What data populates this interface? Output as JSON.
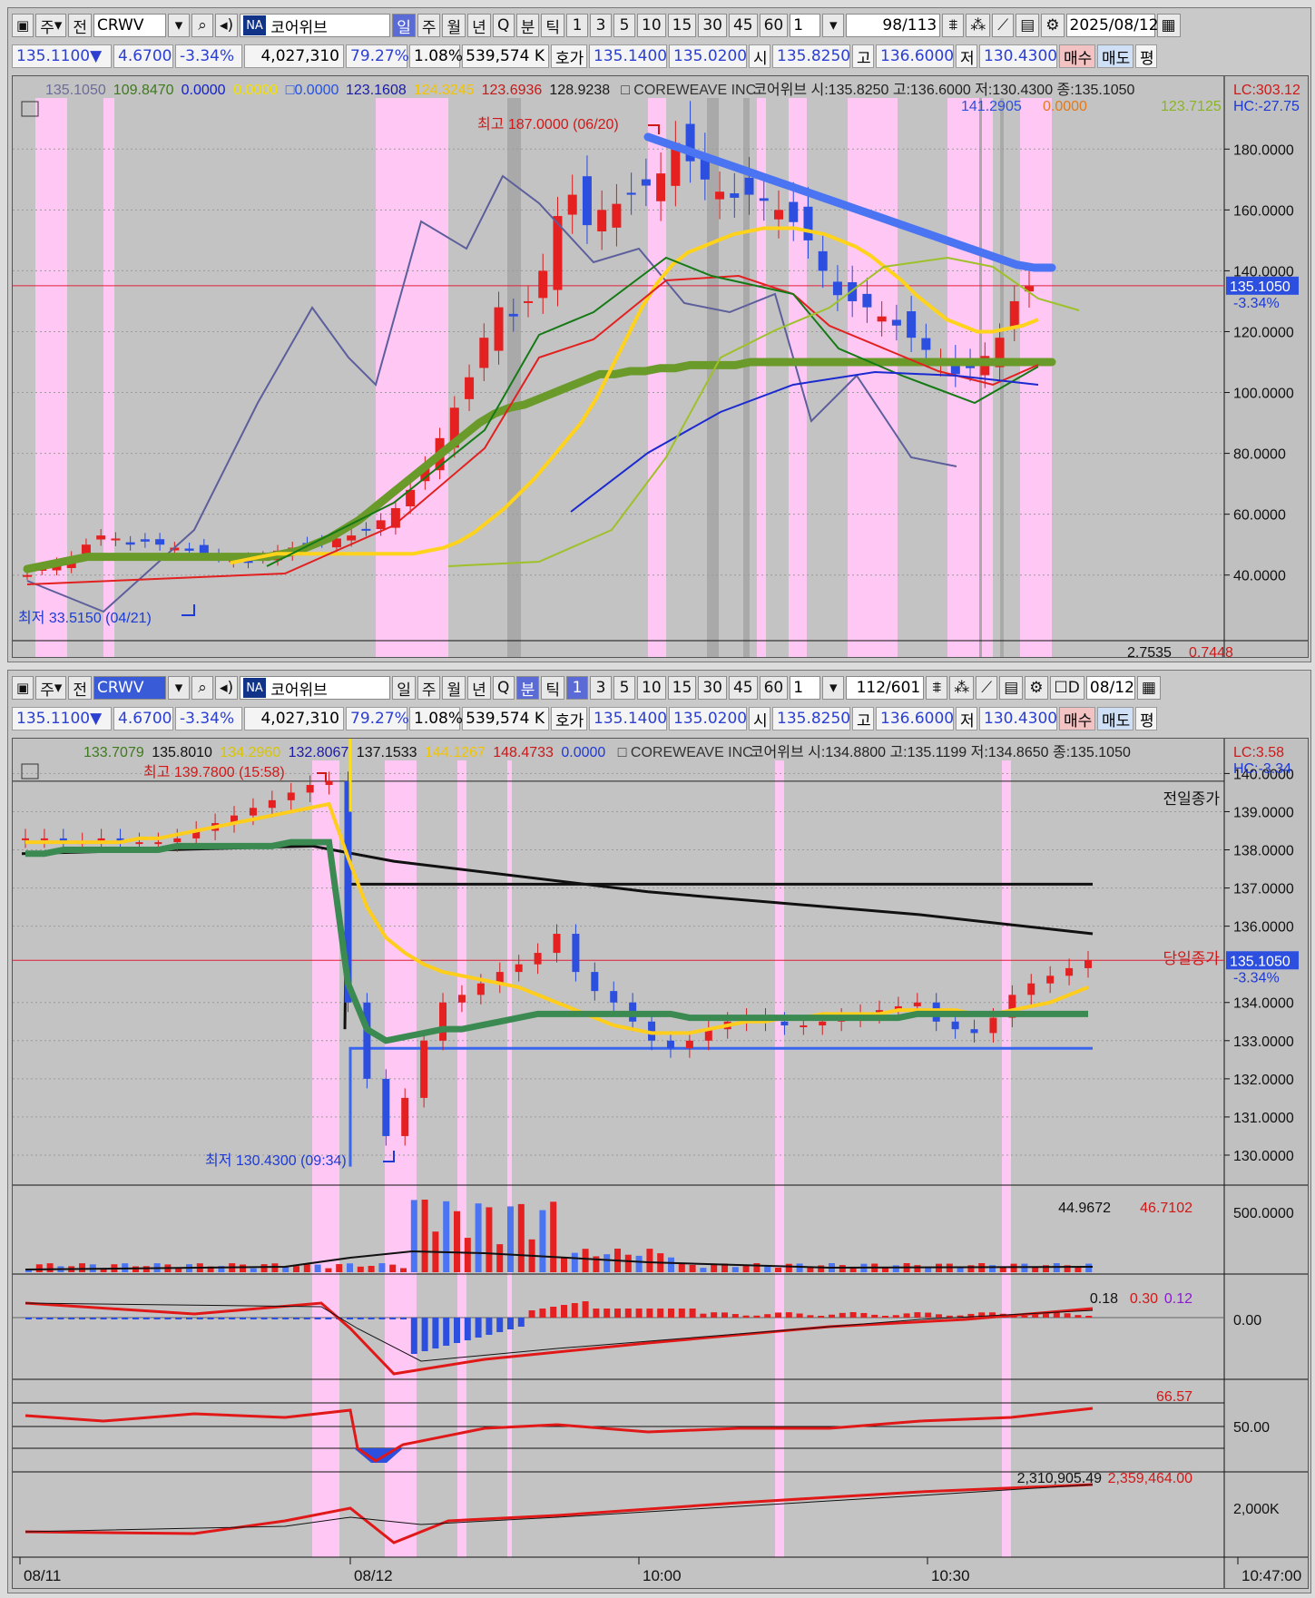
{
  "daily_panel": {
    "toolbar": {
      "type_main": "주",
      "type_all": "전",
      "symbol": "CRWV",
      "market_badge": "NA",
      "company": "코어위브",
      "periods": [
        "일",
        "주",
        "월",
        "년",
        "Q"
      ],
      "active_period": "일",
      "minute": "분",
      "tick": "틱",
      "intervals": [
        "1",
        "3",
        "5",
        "10",
        "15",
        "30",
        "45",
        "60"
      ],
      "interval_input": "1",
      "count": "98",
      "total": "/113",
      "date": "2025/08/12"
    },
    "quote": {
      "price": "135.1100▼",
      "change": "4.6700",
      "rate": "-3.34%",
      "volume": "4,027,310",
      "vol_ratio": "79.27%",
      "turnover": "1.08%",
      "amount": "539,574 K",
      "bid_label": "호가",
      "ask": "135.1400",
      "bid": "135.0200",
      "open_label": "시",
      "open": "135.8250",
      "high_label": "고",
      "high": "136.6000",
      "low_label": "저",
      "low": "130.4300",
      "buy": "매수",
      "sell": "매도",
      "avg": "평"
    },
    "legend": {
      "v1": "135.1050",
      "v2": "109.8470",
      "v3": "0.0000",
      "v4": "0.0000",
      "v5": "0.0000",
      "v6": "123.1608",
      "v7": "124.3245",
      "v8": "123.6936",
      "v9": "128.9238",
      "title": "COREWEAVE INC",
      "info": "코어위브 시:135.8250 고:136.6000 저:130.4300 종:135.1050",
      "l2a": "141.2905",
      "l2b": "0.0000",
      "l2c": "123.7125",
      "lc": "LC:303.12",
      "hc": "HC:-27.75"
    },
    "annotations": {
      "high": "최고 187.0000 (06/20)",
      "low": "최저 33.5150 (04/21)",
      "price_tag": "135.1050",
      "price_rate": "-3.34%",
      "bottom_left": "2.7535",
      "bottom_right": "0.7448"
    },
    "y_axis": [
      "180.0000",
      "160.0000",
      "140.0000",
      "120.0000",
      "100.0000",
      "80.0000",
      "60.0000",
      "40.0000"
    ]
  },
  "minute_panel": {
    "toolbar": {
      "type_main": "주",
      "type_all": "전",
      "symbol": "CRWV",
      "market_badge": "NA",
      "company": "코어위브",
      "periods": [
        "일",
        "주",
        "월",
        "년",
        "Q"
      ],
      "minute": "분",
      "tick": "틱",
      "intervals": [
        "1",
        "3",
        "5",
        "10",
        "15",
        "30",
        "45",
        "60"
      ],
      "active_interval": "1",
      "interval_input": "1",
      "count": "112",
      "total": "/601",
      "d_label": "D",
      "date": "08/12"
    },
    "legend": {
      "v1": "133.7079",
      "v2": "135.8010",
      "v3": "134.2960",
      "v4": "132.8067",
      "v5": "137.1533",
      "v6": "144.1267",
      "v7": "148.4733",
      "v8": "0.0000",
      "title": "COREWEAVE INC",
      "info": "코어위브 시:134.8800 고:135.1199 저:134.8650 종:135.1050",
      "lc": "LC:3.58",
      "hc": "HC:-3.34"
    },
    "annotations": {
      "high": "최고 139.7800 (15:58)",
      "low": "최저 130.4300 (09:34)",
      "prev_close": "전일종가",
      "today_close": "당일종가",
      "price_tag": "135.1050",
      "price_rate": "-3.34%"
    },
    "y_axis": [
      "140.0000",
      "139.0000",
      "138.0000",
      "137.0000",
      "136.0000",
      "134.0000",
      "133.0000",
      "132.0000",
      "131.0000",
      "130.0000"
    ],
    "volume": {
      "v1": "44.9672",
      "v2": "46.7102",
      "axis": "500.0000"
    },
    "macd": {
      "v1": "0.18",
      "v2": "0.30",
      "v3": "0.12",
      "axis": "0.00"
    },
    "rsi": {
      "v1": "66.57",
      "axis": "50.00"
    },
    "obv": {
      "v1": "2,310,905.49",
      "v2": "2,359,464.00",
      "axis": "2,000K"
    },
    "x_axis": [
      "08/11",
      "08/12",
      "10:00",
      "10:30",
      "10:47:00"
    ]
  },
  "chart_data": [
    {
      "type": "line",
      "title": "COREWEAVE INC",
      "series_note": "daily candles with moving averages",
      "ylim": [
        25,
        195
      ],
      "close": [
        40,
        42,
        44,
        46,
        50,
        53,
        52,
        50,
        51,
        50,
        49,
        48,
        47,
        46,
        45,
        44,
        46,
        48,
        49,
        50,
        51,
        52,
        53,
        55,
        58,
        62,
        68,
        76,
        85,
        95,
        105,
        118,
        128,
        125,
        130,
        140,
        158,
        165,
        155,
        160,
        162,
        165,
        168,
        172,
        182,
        176,
        170,
        166,
        164,
        165,
        163,
        160,
        156,
        150,
        140,
        132,
        130,
        128,
        125,
        122,
        118,
        114,
        110,
        106,
        108,
        112,
        118,
        130,
        135
      ],
      "ma_green_thick": [
        42,
        43,
        44,
        45,
        46,
        46,
        46,
        46,
        46,
        46,
        46,
        46,
        46,
        46,
        46,
        46,
        46,
        47,
        48,
        50,
        52,
        55,
        58,
        62,
        66,
        70,
        74,
        78,
        82,
        86,
        90,
        93,
        95,
        96,
        98,
        100,
        102,
        104,
        106,
        106,
        107,
        107,
        108,
        108,
        109,
        109,
        109,
        109,
        110,
        110,
        110,
        110,
        110,
        110,
        110,
        110,
        110,
        110,
        110,
        110,
        110,
        110,
        110,
        110,
        110,
        110,
        110,
        110,
        110
      ],
      "ma_blue_thick": [
        184,
        182,
        180,
        178,
        176,
        174,
        172,
        170,
        168,
        166,
        164,
        162,
        160,
        158,
        156,
        154,
        152,
        150,
        148,
        146,
        144,
        142,
        141,
        141
      ],
      "ma_yellow": [
        44,
        45,
        46,
        47,
        47,
        47,
        47,
        47,
        47,
        47,
        47,
        47,
        47,
        48,
        49,
        51,
        54,
        58,
        62,
        67,
        72,
        78,
        84,
        90,
        98,
        108,
        118,
        128,
        136,
        142,
        146,
        148,
        150,
        152,
        153,
        154,
        154,
        154,
        153,
        152,
        150,
        148,
        145,
        141,
        137,
        132,
        128,
        124,
        122,
        120,
        120,
        121,
        122,
        124
      ]
    },
    {
      "type": "line",
      "title": "COREWEAVE INC",
      "series_note": "1-minute candles 08/11-08/12",
      "ylim": [
        129.5,
        140.2
      ],
      "close": [
        138.3,
        138.3,
        138.2,
        138.2,
        138.3,
        138.2,
        138.2,
        138.2,
        138.3,
        138.5,
        138.7,
        138.9,
        139.1,
        139.3,
        139.5,
        139.7,
        139.8,
        134.0,
        132.0,
        130.5,
        131.5,
        133.0,
        134.0,
        134.2,
        134.5,
        134.8,
        135.0,
        135.3,
        135.8,
        134.8,
        134.3,
        134.0,
        133.5,
        133.0,
        132.8,
        133.0,
        133.3,
        133.5,
        133.6,
        133.5,
        133.4,
        133.4,
        133.5,
        133.6,
        133.7,
        133.8,
        133.9,
        134.0,
        133.5,
        133.3,
        133.2,
        133.6,
        134.2,
        134.5,
        134.7,
        134.9,
        135.1
      ],
      "ma_yellow": [
        138.2,
        138.2,
        138.2,
        138.2,
        138.2,
        138.2,
        138.3,
        138.3,
        138.4,
        138.5,
        138.6,
        138.7,
        138.8,
        138.9,
        139.0,
        139.1,
        139.2,
        137.8,
        136.5,
        135.7,
        135.3,
        135.0,
        134.8,
        134.7,
        134.6,
        134.5,
        134.4,
        134.2,
        134.0,
        133.8,
        133.6,
        133.4,
        133.3,
        133.2,
        133.2,
        133.2,
        133.3,
        133.4,
        133.5,
        133.5,
        133.6,
        133.6,
        133.7,
        133.7,
        133.7,
        133.7,
        133.8,
        133.8,
        133.8,
        133.8,
        133.7,
        133.7,
        133.8,
        133.9,
        134.0,
        134.2,
        134.4
      ],
      "ma_green": [
        137.9,
        137.9,
        138.0,
        138.0,
        138.0,
        138.0,
        138.0,
        138.0,
        138.1,
        138.1,
        138.1,
        138.1,
        138.1,
        138.1,
        138.2,
        138.2,
        138.2,
        134.5,
        133.3,
        133.0,
        133.1,
        133.2,
        133.3,
        133.3,
        133.4,
        133.5,
        133.6,
        133.7,
        133.7,
        133.7,
        133.7,
        133.7,
        133.7,
        133.7,
        133.7,
        133.6,
        133.6,
        133.6,
        133.6,
        133.6,
        133.6,
        133.6,
        133.6,
        133.6,
        133.6,
        133.6,
        133.6,
        133.7,
        133.7,
        133.7,
        133.7,
        133.7,
        133.7,
        133.7,
        133.7,
        133.7,
        133.7
      ],
      "prev_close": 139.8,
      "today_close": 135.105
    }
  ]
}
